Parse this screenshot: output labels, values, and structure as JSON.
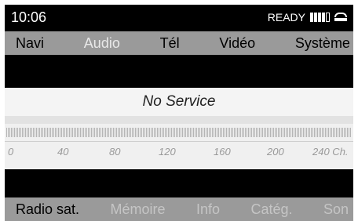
{
  "status": {
    "time": "10:06",
    "state": "READY",
    "signal_bars": 4,
    "signal_total": 5,
    "phone_icon": "phone-handset-icon"
  },
  "top_menu": {
    "items": [
      {
        "label": "Navi",
        "active": false
      },
      {
        "label": "Audio",
        "active": true
      },
      {
        "label": "Tél",
        "active": false
      },
      {
        "label": "Vidéo",
        "active": false
      },
      {
        "label": "Système",
        "active": false
      }
    ]
  },
  "main": {
    "service_text": "No Service",
    "scale_labels": [
      "0",
      "40",
      "80",
      "120",
      "160",
      "200",
      "240 Ch."
    ]
  },
  "bottom_menu": {
    "items": [
      {
        "label": "Radio sat.",
        "active": true
      },
      {
        "label": "Mémoire",
        "active": false
      },
      {
        "label": "Info",
        "active": false
      },
      {
        "label": "Catég.",
        "active": false
      },
      {
        "label": "Son",
        "active": false
      }
    ]
  },
  "colors": {
    "background": "#000000",
    "menubar": "#9a9a9a",
    "active_top": "#e8e8e8",
    "inactive_bottom": "#c5c5c5"
  }
}
